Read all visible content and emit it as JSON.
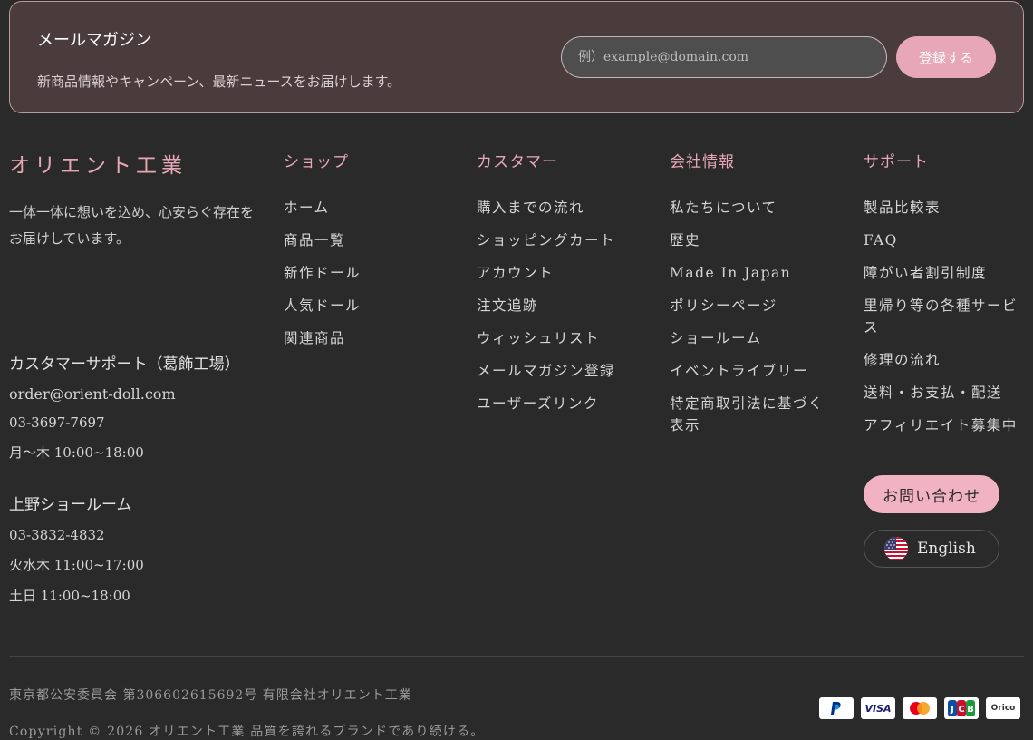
{
  "newsletter": {
    "title": "メールマガジン",
    "description": "新商品情報やキャンペーン、最新ニュースをお届けします。",
    "email_placeholder": "例）example@domain.com",
    "submit_label": "登録する"
  },
  "brand": {
    "name": "オリエント工業",
    "description": "一体一体に想いを込め、心安らぐ存在をお届けしています。"
  },
  "contact": {
    "factory": {
      "title": "カスタマーサポート（葛飾工場）",
      "email": "order@orient-doll.com",
      "phone": "03-3697-7697",
      "hours": "月〜木 10:00~18:00"
    },
    "showroom": {
      "title": "上野ショールーム",
      "phone": "03-3832-4832",
      "hours_weekday": "火水木 11:00~17:00",
      "hours_weekend": "土日 11:00~18:00"
    }
  },
  "columns": [
    {
      "heading": "ショップ",
      "items": [
        "ホーム",
        "商品一覧",
        "新作ドール",
        "人気ドール",
        "関連商品"
      ]
    },
    {
      "heading": "カスタマー",
      "items": [
        "購入までの流れ",
        "ショッピングカート",
        "アカウント",
        "注文追跡",
        "ウィッシュリスト",
        "メールマガジン登録",
        "ユーザーズリンク"
      ]
    },
    {
      "heading": "会社情報",
      "items": [
        "私たちについて",
        "歴史",
        "Made In Japan",
        "ポリシーページ",
        "ショールーム",
        "イベントライブリー",
        "特定商取引法に基づく表示"
      ]
    },
    {
      "heading": "サポート",
      "items": [
        "製品比較表",
        "FAQ",
        "障がい者割引制度",
        "里帰り等の各種サービス",
        "修理の流れ",
        "送料・お支払・配送",
        "アフィリエイト募集中"
      ]
    }
  ],
  "support_button_label": "お問い合わせ",
  "language": {
    "label": "English",
    "flag_icon": "us-flag-icon"
  },
  "footer": {
    "legal": "東京都公安委員会 第306602615692号 有限会社オリエント工業",
    "copyright": "Copyright © 2026 オリエント工業 品質を誇れるブランドであり続ける。"
  },
  "payments": [
    {
      "name": "paypal",
      "label": "P",
      "color": "#003087"
    },
    {
      "name": "visa",
      "label": "VISA",
      "color": "#1a1f71"
    },
    {
      "name": "mastercard",
      "label": "",
      "color": "#eb001b"
    },
    {
      "name": "jcb",
      "label": "JCB",
      "color": "#0b4ea2"
    },
    {
      "name": "orico",
      "label": "Orico",
      "color": "#e84a1f"
    }
  ]
}
